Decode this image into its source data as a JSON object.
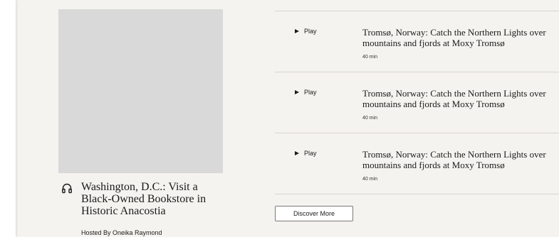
{
  "card": {
    "title": "Washington, D.C.: Visit a Black-Owned Bookstore in Historic Anacostia",
    "host": "Hosted By Oneika Raymond"
  },
  "episodes": [
    {
      "play_label": "Play",
      "title": "Tromsø, Norway: Catch the Northern Lights over mountains and fjords at Moxy Tromsø",
      "duration": "40 min"
    },
    {
      "play_label": "Play",
      "title": "Tromsø, Norway: Catch the Northern Lights over mountains and fjords at Moxy Tromsø",
      "duration": "40 min"
    },
    {
      "play_label": "Play",
      "title": "Tromsø, Norway: Catch the Northern Lights over mountains and fjords at Moxy Tromsø",
      "duration": "40 min"
    }
  ],
  "discover_label": "Discover More",
  "icons": {
    "headphones": "headphones-icon",
    "play": "play-icon"
  }
}
